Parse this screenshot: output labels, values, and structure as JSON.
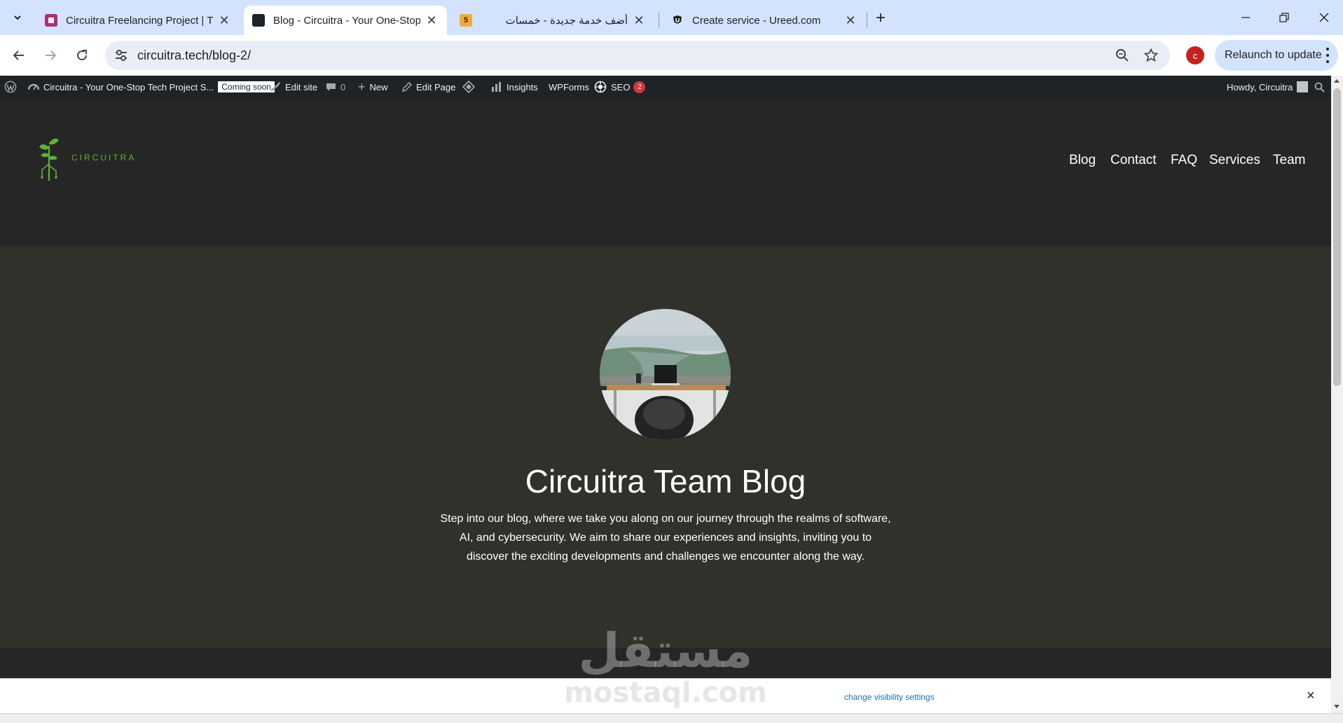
{
  "browser": {
    "tabs": [
      {
        "title": "Circuitra Freelancing Project | Tr",
        "favicon_color": "#b0306f"
      },
      {
        "title": "Blog - Circuitra - Your One-Stop",
        "favicon_color": "#1d2327"
      },
      {
        "title": "",
        "favicon_color": "#f2a93b",
        "favicon_text": "5"
      },
      {
        "title": "أضف خدمة جديدة - خمسات",
        "favicon_color": "#ffffff"
      },
      {
        "title": "Create service - Ureed.com",
        "favicon_color": "#1f1f1f"
      }
    ],
    "url": "circuitra.tech/blog-2/",
    "profile_initial": "c",
    "relaunch_label": "Relaunch to update"
  },
  "adminbar": {
    "site_name": "Circuitra - Your One-Stop Tech Project S...",
    "coming_soon": "Coming soon",
    "edit_site": "Edit site",
    "comments_count": "0",
    "new": "New",
    "edit_page": "Edit Page",
    "insights": "Insights",
    "wpforms": "WPForms",
    "seo": "SEO",
    "seo_count": "2",
    "howdy": "Howdy, Circuitra"
  },
  "site": {
    "logo_text": "CIRCUITRA",
    "brand_color": "#5fb13b",
    "menu": [
      "Blog",
      "Contact",
      "FAQ",
      "Services",
      "Team"
    ]
  },
  "hero": {
    "title": "Circuitra Team Blog",
    "text": "Step into our blog, where we take you along on our journey through the realms of software, AI, and cybersecurity. We aim to share our experiences and insights, inviting you to discover the exciting developments and challenges we encounter along the way."
  },
  "notice": {
    "link": "change visibility settings",
    "close": "×"
  },
  "watermark": {
    "arabic": "مستقل",
    "latin": "mostaql.com"
  }
}
